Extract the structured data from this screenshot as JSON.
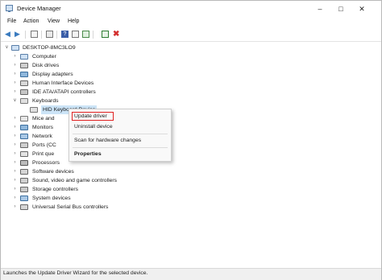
{
  "window": {
    "title": "Device Manager"
  },
  "menubar": {
    "items": [
      "File",
      "Action",
      "View",
      "Help"
    ]
  },
  "toolbar": {
    "buttons": [
      "back-icon",
      "forward-icon",
      "show-hide-console-tree-icon",
      "properties-icon",
      "help-icon",
      "update-driver-icon",
      "scan-hardware-icon",
      "uninstall-icon"
    ]
  },
  "tree": {
    "root": "DESKTOP-8MC3LO9",
    "items": [
      "Computer",
      "Disk drives",
      "Display adapters",
      "Human Interface Devices",
      "IDE ATA/ATAPI controllers",
      "Keyboards",
      "HID Keyboard Device",
      "Mice and",
      "Monitors",
      "Network",
      "Ports (CC",
      "Print que",
      "Processors",
      "Software devices",
      "Sound, video and game controllers",
      "Storage controllers",
      "System devices",
      "Universal Serial Bus controllers"
    ]
  },
  "context_menu": {
    "update_driver": "Update driver",
    "uninstall_device": "Uninstall device",
    "scan_changes": "Scan for hardware changes",
    "properties": "Properties"
  },
  "status": {
    "text": "Launches the Update Driver Wizard for the selected device."
  },
  "colors": {
    "highlight": "#cce4f7",
    "annotation": "#e02020",
    "uninstall_x": "#d32f2f"
  }
}
